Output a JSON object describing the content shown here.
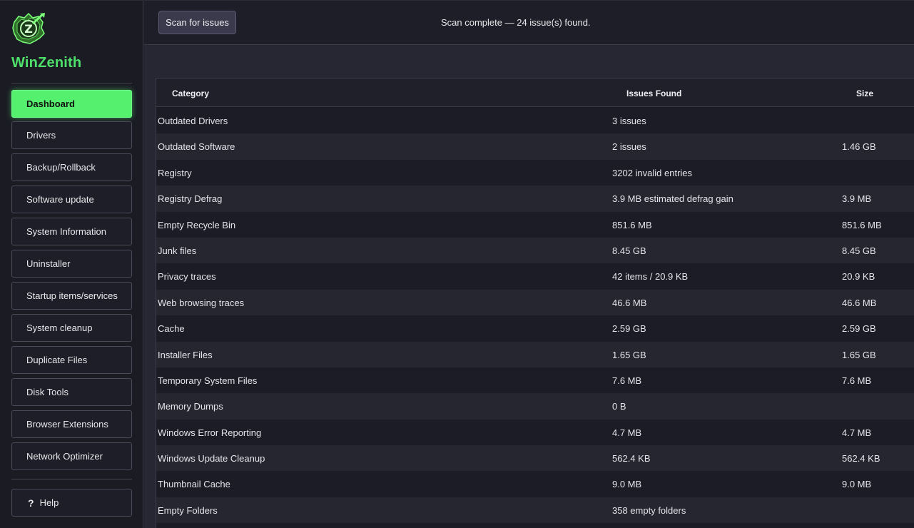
{
  "app": {
    "title": "WinZenith"
  },
  "sidebar": {
    "items": [
      {
        "label": "Dashboard",
        "active": true
      },
      {
        "label": "Drivers"
      },
      {
        "label": "Backup/Rollback"
      },
      {
        "label": "Software update"
      },
      {
        "label": "System Information"
      },
      {
        "label": "Uninstaller"
      },
      {
        "label": "Startup items/services"
      },
      {
        "label": "System cleanup"
      },
      {
        "label": "Duplicate Files"
      },
      {
        "label": "Disk Tools"
      },
      {
        "label": "Browser Extensions"
      },
      {
        "label": "Network Optimizer"
      }
    ],
    "help": {
      "icon": "?",
      "label": "Help"
    }
  },
  "toolbar": {
    "scan_label": "Scan for issues",
    "status_text": "Scan complete — 24 issue(s) found."
  },
  "table": {
    "headers": {
      "category": "Category",
      "issues": "Issues Found",
      "size": "Size"
    },
    "rows": [
      {
        "category": "Outdated Drivers",
        "issues": "3 issues",
        "size": ""
      },
      {
        "category": "Outdated Software",
        "issues": "2 issues",
        "size": "1.46 GB"
      },
      {
        "category": "Registry",
        "issues": "3202 invalid entries",
        "size": ""
      },
      {
        "category": "Registry Defrag",
        "issues": "3.9 MB estimated defrag gain",
        "size": "3.9 MB"
      },
      {
        "category": "Empty Recycle Bin",
        "issues": "851.6 MB",
        "size": "851.6 MB"
      },
      {
        "category": "Junk files",
        "issues": "8.45 GB",
        "size": "8.45 GB"
      },
      {
        "category": "Privacy traces",
        "issues": "42 items / 20.9 KB",
        "size": "20.9 KB"
      },
      {
        "category": "Web browsing traces",
        "issues": "46.6 MB",
        "size": "46.6 MB"
      },
      {
        "category": "Cache",
        "issues": "2.59 GB",
        "size": "2.59 GB"
      },
      {
        "category": "Installer Files",
        "issues": "1.65 GB",
        "size": "1.65 GB"
      },
      {
        "category": "Temporary System Files",
        "issues": "7.6 MB",
        "size": "7.6 MB"
      },
      {
        "category": "Memory Dumps",
        "issues": "0 B",
        "size": ""
      },
      {
        "category": "Windows Error Reporting",
        "issues": "4.7 MB",
        "size": "4.7 MB"
      },
      {
        "category": "Windows Update Cleanup",
        "issues": "562.4 KB",
        "size": "562.4 KB"
      },
      {
        "category": "Thumbnail Cache",
        "issues": "9.0 MB",
        "size": "9.0 MB"
      },
      {
        "category": "Empty Folders",
        "issues": "358 empty folders",
        "size": ""
      }
    ]
  },
  "colors": {
    "accent": "#54f06e",
    "brand_text": "#4ee06a",
    "background": "#1e1e28"
  }
}
